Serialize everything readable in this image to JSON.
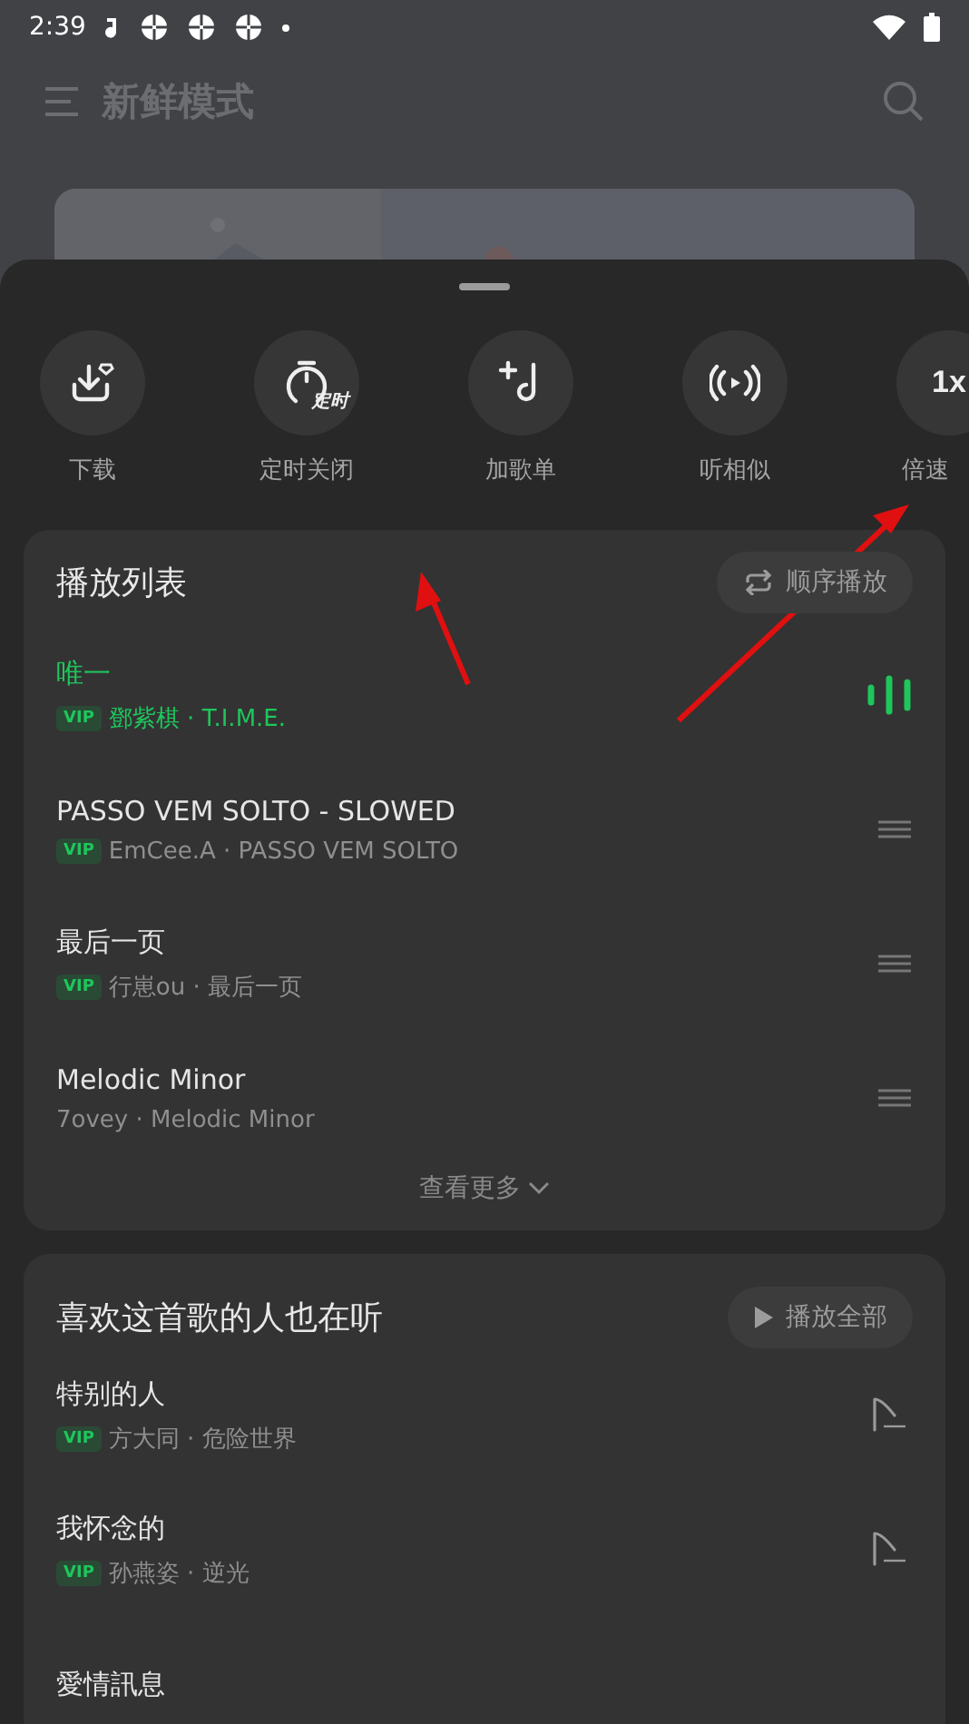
{
  "status_bar": {
    "time": "2:39"
  },
  "background_page": {
    "title": "新鲜模式"
  },
  "actions": [
    {
      "kind": "download",
      "label": "下载"
    },
    {
      "kind": "timer",
      "label": "定时关闭",
      "icon_text": "定时"
    },
    {
      "kind": "add",
      "label": "加歌单"
    },
    {
      "kind": "similar",
      "label": "听相似"
    },
    {
      "kind": "speed",
      "label": "倍速",
      "icon_text": "1x"
    }
  ],
  "playlist": {
    "title": "播放列表",
    "mode_button": "顺序播放",
    "more": "查看更多",
    "songs": [
      {
        "title": "唯一",
        "badge": "VIP",
        "subtitle": "鄧紫棋 · T.I.M.E.",
        "playing": true
      },
      {
        "title": "PASSO VEM SOLTO - SLOWED",
        "badge": "VIP",
        "subtitle": "EmCee.A · PASSO VEM SOLTO",
        "playing": false
      },
      {
        "title": "最后一页",
        "badge": "VIP",
        "subtitle": "行崽ou · 最后一页",
        "playing": false
      },
      {
        "title": "Melodic Minor",
        "subtitle": "7ovey · Melodic Minor",
        "playing": false
      }
    ]
  },
  "similar": {
    "title": "喜欢这首歌的人也在听",
    "play_all_button": "播放全部",
    "songs": [
      {
        "title": "特别的人",
        "badge": "VIP",
        "subtitle": "方大同 · 危险世界"
      },
      {
        "title": "我怀念的",
        "badge": "VIP",
        "subtitle": "孙燕姿 · 逆光"
      },
      {
        "title": "愛情訊息"
      }
    ]
  }
}
